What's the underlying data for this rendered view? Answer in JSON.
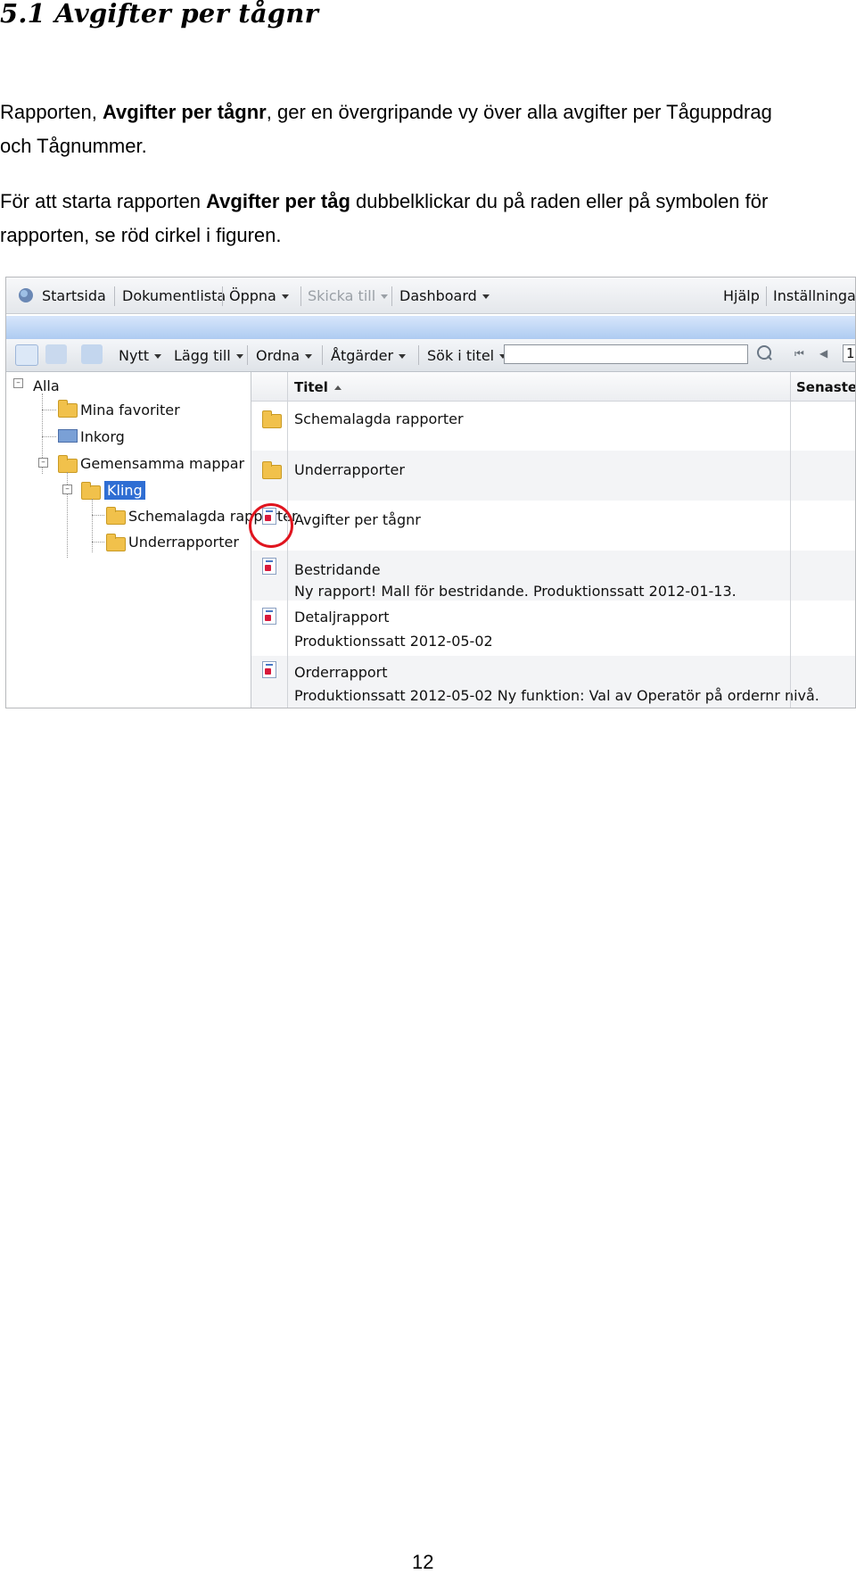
{
  "heading": "5.1 Avgifter per tågnr",
  "paragraph1": {
    "prefix": "Rapporten, ",
    "bold": "Avgifter per tågnr",
    "suffix": ", ger en övergripande vy över alla avgifter per Tåguppdrag och Tågnummer."
  },
  "paragraph2": {
    "prefix": "För att starta rapporten ",
    "bold": "Avgifter per tåg",
    "suffix": " dubbelklickar du på raden eller på symbolen för rapporten, se röd cirkel i figuren."
  },
  "app": {
    "topbar": {
      "home": "Startsida",
      "doclist": "Dokumentlista",
      "open": "Öppna",
      "send": "Skicka till",
      "dashboard": "Dashboard",
      "help": "Hjälp",
      "settings": "Inställningar"
    },
    "toolbar": {
      "new": "Nytt",
      "add": "Lägg till",
      "organize": "Ordna",
      "actions": "Åtgärder",
      "search_label": "Sök i titel",
      "search_value": "",
      "page": "1"
    },
    "tree": {
      "root": "Alla",
      "favorites": "Mina favoriter",
      "inbox": "Inkorg",
      "shared": "Gemensamma mappar",
      "kling": "Kling",
      "scheduled": "Schemalagda rapporter",
      "subreports": "Underrapporter"
    },
    "list": {
      "col_title": "Titel",
      "col_latest": "Senaste",
      "rows": [
        {
          "title": "Schemalagda rapporter",
          "desc": ""
        },
        {
          "title": "Underrapporter",
          "desc": ""
        },
        {
          "title": "Avgifter per tågnr",
          "desc": ""
        },
        {
          "title": "Bestridande",
          "desc": "Ny rapport! Mall för bestridande. Produktionssatt 2012-01-13."
        },
        {
          "title": "Detaljrapport",
          "desc": "Produktionssatt 2012-05-02"
        },
        {
          "title": "Orderrapport",
          "desc": "Produktionssatt 2012-05-02 Ny funktion: Val av Operatör på ordernr nivå."
        }
      ]
    },
    "colors": {
      "highlight_circle": "#e0141e",
      "selected_node": "#2f6ed3",
      "blue_band": "#aecbf1"
    }
  },
  "page_number": "12"
}
